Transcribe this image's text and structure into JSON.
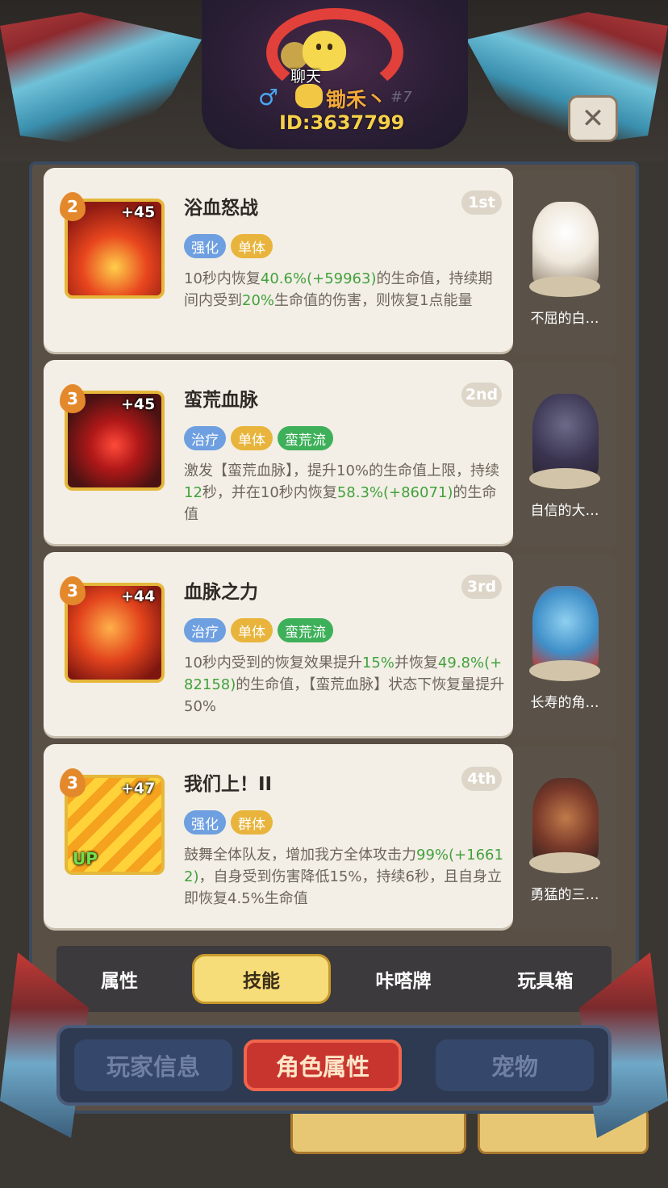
{
  "header": {
    "chat_label": "聊天",
    "gender_symbol": "♂",
    "player_name": "锄禾丶",
    "rank": "#7",
    "player_id": "ID:3637799",
    "close_symbol": "✕"
  },
  "skills": [
    {
      "name": "浴血怒战",
      "order": "1st",
      "level": "2",
      "bonus": "+45",
      "tags": [
        "强化",
        "单体"
      ],
      "desc_parts": [
        {
          "t": "10秒内恢复",
          "g": false
        },
        {
          "t": "40.6%(+59963)",
          "g": true
        },
        {
          "t": "的生命值，持续期间内受到",
          "g": false
        },
        {
          "t": "20%",
          "g": true
        },
        {
          "t": "生命值的伤害，则恢复1点能量",
          "g": false
        }
      ],
      "pet_name": "不屈的白…"
    },
    {
      "name": "蛮荒血脉",
      "order": "2nd",
      "level": "3",
      "bonus": "+45",
      "tags": [
        "治疗",
        "单体",
        "蛮荒流"
      ],
      "desc_parts": [
        {
          "t": "激发【蛮荒血脉】，提升10%的生命值上限，持续",
          "g": false
        },
        {
          "t": "12",
          "g": true
        },
        {
          "t": "秒，并在10秒内恢复",
          "g": false
        },
        {
          "t": "58.3%(+86071)",
          "g": true
        },
        {
          "t": "的生命值",
          "g": false
        }
      ],
      "pet_name": "自信的大…"
    },
    {
      "name": "血脉之力",
      "order": "3rd",
      "level": "3",
      "bonus": "+44",
      "tags": [
        "治疗",
        "单体",
        "蛮荒流"
      ],
      "desc_parts": [
        {
          "t": "10秒内受到的恢复效果提升",
          "g": false
        },
        {
          "t": "15%",
          "g": true
        },
        {
          "t": "并恢复",
          "g": false
        },
        {
          "t": "49.8%(+82158)",
          "g": true
        },
        {
          "t": "的生命值，【蛮荒血脉】状态下恢复量提升50%",
          "g": false
        }
      ],
      "pet_name": "长寿的角…"
    },
    {
      "name": "我们上！II",
      "order": "4th",
      "level": "3",
      "bonus": "+47",
      "up_label": "UP",
      "tags": [
        "强化",
        "群体"
      ],
      "desc_parts": [
        {
          "t": "鼓舞全体队友，增加我方全体攻击力",
          "g": false
        },
        {
          "t": "99%(+16612)",
          "g": true
        },
        {
          "t": "，自身受到伤害降低15%，持续6秒，且自身立即恢复4.5%生命值",
          "g": false
        }
      ],
      "pet_name": "勇猛的三…"
    }
  ],
  "tabs": [
    "属性",
    "技能",
    "咔嗒牌",
    "玩具箱"
  ],
  "active_tab": 1,
  "bottom_nav": [
    "玩家信息",
    "角色属性",
    "宠物"
  ],
  "active_bottom": 1,
  "colors": {
    "accent_green": "#43a13e",
    "tag_blue": "#6e9fe0",
    "tag_yellow": "#e8b43c",
    "tag_green": "#3eb05a",
    "name_orange": "#f2a93a",
    "id_yellow": "#f6d04a"
  },
  "icons": {
    "close": "close-icon",
    "chat": "chat-icon",
    "gender": "male-icon"
  }
}
